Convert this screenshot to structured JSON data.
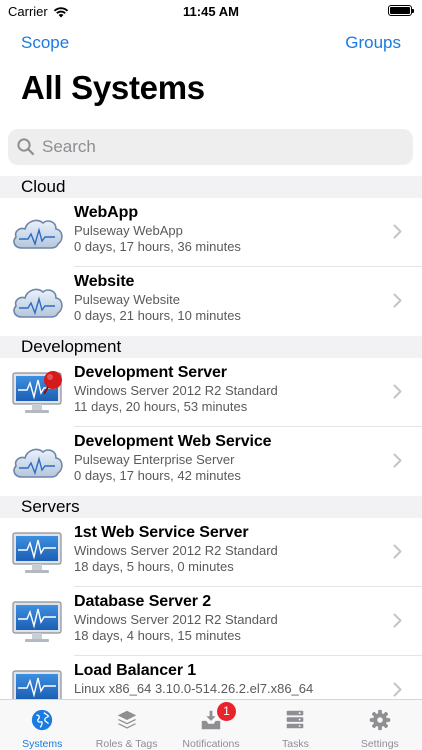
{
  "status": {
    "carrier": "Carrier",
    "time": "11:45 AM"
  },
  "nav": {
    "left": "Scope",
    "right": "Groups",
    "title": "All Systems"
  },
  "search": {
    "placeholder": "Search"
  },
  "sections": [
    {
      "name": "Cloud",
      "items": [
        {
          "title": "WebApp",
          "subtitle": "Pulseway WebApp",
          "uptime": "0 days, 17 hours, 36 minutes",
          "icon": "cloud-icon"
        },
        {
          "title": "Website",
          "subtitle": "Pulseway Website",
          "uptime": "0 days, 21 hours, 10 minutes",
          "icon": "cloud-icon"
        }
      ]
    },
    {
      "name": "Development",
      "items": [
        {
          "title": "Development Server",
          "subtitle": "Windows Server 2012 R2 Standard",
          "uptime": "11 days, 20 hours, 53 minutes",
          "icon": "monitor-alert-icon"
        },
        {
          "title": "Development Web Service",
          "subtitle": "Pulseway Enterprise Server",
          "uptime": "0 days, 17 hours, 42 minutes",
          "icon": "cloud-icon"
        }
      ]
    },
    {
      "name": "Servers",
      "items": [
        {
          "title": "1st Web Service Server",
          "subtitle": "Windows Server 2012 R2 Standard",
          "uptime": "18 days, 5 hours, 0 minutes",
          "icon": "monitor-icon"
        },
        {
          "title": "Database Server 2",
          "subtitle": "Windows Server 2012 R2 Standard",
          "uptime": "18 days, 4 hours, 15 minutes",
          "icon": "monitor-icon"
        },
        {
          "title": "Load Balancer 1",
          "subtitle": "Linux x86_64 3.10.0-514.26.2.el7.x86_64",
          "uptime": "",
          "icon": "monitor-icon"
        }
      ]
    }
  ],
  "tabs": [
    {
      "label": "Systems",
      "icon": "globe-icon",
      "active": true
    },
    {
      "label": "Roles & Tags",
      "icon": "layers-icon",
      "active": false
    },
    {
      "label": "Notifications",
      "icon": "notification-tray-icon",
      "active": false,
      "badge": "1"
    },
    {
      "label": "Tasks",
      "icon": "server-stack-icon",
      "active": false
    },
    {
      "label": "Settings",
      "icon": "gear-icon",
      "active": false
    }
  ],
  "colors": {
    "accent": "#1a7be0",
    "badge": "#e8242a"
  }
}
